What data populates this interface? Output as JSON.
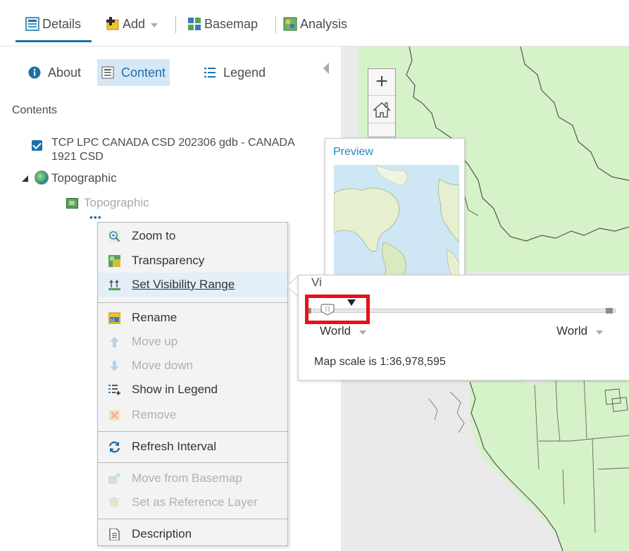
{
  "toolbar": {
    "details_label": "Details",
    "add_label": "Add",
    "basemap_label": "Basemap",
    "analysis_label": "Analysis"
  },
  "panel": {
    "tabs": [
      {
        "label": "About"
      },
      {
        "label": "Content"
      },
      {
        "label": "Legend"
      }
    ],
    "contents_heading": "Contents",
    "layer_title": "TCP LPC CANADA CSD 202306 gdb - CANADA 1921 CSD",
    "group_label": "Topographic",
    "sublayer_label": "Topographic",
    "more_label": "•••"
  },
  "context_menu": {
    "items": [
      {
        "label": "Zoom to",
        "icon": "zoom-to-icon",
        "enabled": true
      },
      {
        "label": "Transparency",
        "icon": "transparency-icon",
        "enabled": true
      },
      {
        "label": "Set Visibility Range",
        "icon": "visibility-range-icon",
        "enabled": true,
        "highlighted": true
      },
      {
        "label": "Rename",
        "icon": "rename-icon",
        "enabled": true
      },
      {
        "label": "Move up",
        "icon": "arrow-up-icon",
        "enabled": false
      },
      {
        "label": "Move down",
        "icon": "arrow-down-icon",
        "enabled": false
      },
      {
        "label": "Show in Legend",
        "icon": "legend-add-icon",
        "enabled": true
      },
      {
        "label": "Remove",
        "icon": "remove-icon",
        "enabled": false
      },
      {
        "label": "Refresh Interval",
        "icon": "refresh-icon",
        "enabled": true
      },
      {
        "label": "Move from Basemap",
        "icon": "move-basemap-icon",
        "enabled": false
      },
      {
        "label": "Set as Reference Layer",
        "icon": "reference-layer-icon",
        "enabled": false
      },
      {
        "label": "Description",
        "icon": "description-icon",
        "enabled": true
      }
    ]
  },
  "map": {
    "zoom_in_label": "+"
  },
  "preview": {
    "title": "Preview"
  },
  "visibility_popup": {
    "title_partial": "Vi",
    "min_scale": "World",
    "max_scale": "World",
    "map_scale_text": "Map scale is 1:36,978,595"
  },
  "colors": {
    "accent": "#1e6fa8",
    "highlight_box": "#e8101a",
    "map_land": "#d6f2c9",
    "map_background": "#eaeaea"
  }
}
